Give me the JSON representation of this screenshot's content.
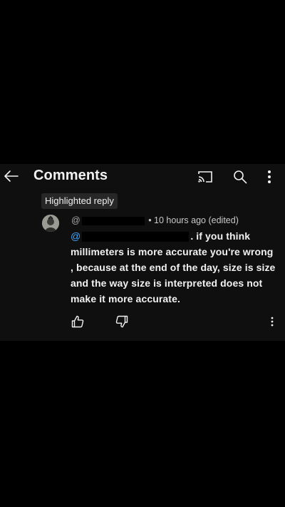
{
  "header": {
    "title": "Comments",
    "back_icon": "arrow-left-icon",
    "cast_icon": "cast-icon",
    "search_icon": "search-icon",
    "more_icon": "more-vert-icon"
  },
  "chip": {
    "label": "Highlighted reply"
  },
  "comment": {
    "handle": "@",
    "timestamp": "• 10 hours ago (edited)",
    "mention": "@",
    "line1_text": ". if you think",
    "body_rest": "millimeters is more accurate you're wrong , because at the end of the day, size is size and the way size is interpreted does not make it more accurate."
  },
  "colors": {
    "background": "#000000",
    "panel": "#0f0f0f",
    "mention": "#3ea6ff",
    "chip": "#272727"
  }
}
